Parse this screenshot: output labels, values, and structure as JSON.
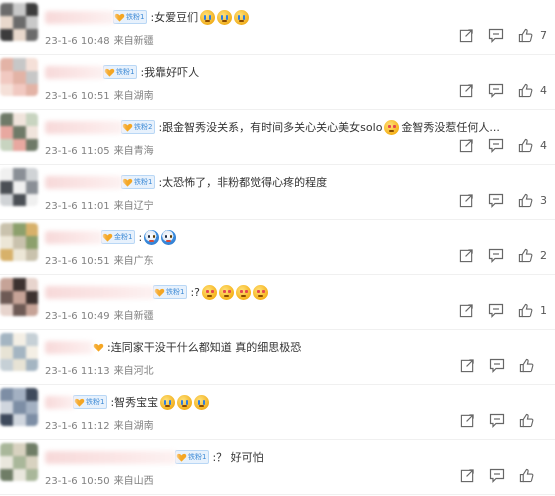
{
  "comments": [
    {
      "text": ":女爱豆们",
      "badge": "铁粉1",
      "time": "23-1-6 10:48",
      "location": "来自新疆",
      "likes": "7",
      "emojis": [
        "cry",
        "cry",
        "cry"
      ],
      "name_w": 70,
      "show_badge": true
    },
    {
      "text": ":我靠好吓人",
      "badge": "铁粉1",
      "time": "23-1-6 10:51",
      "location": "来自湖南",
      "likes": "4",
      "emojis": [],
      "name_w": 60,
      "show_badge": true
    },
    {
      "text": ":跟金智秀没关系，有时间多关心关心美女solo",
      "text2": "金智秀没惹任何人...",
      "badge": "铁粉2",
      "time": "23-1-6 11:05",
      "location": "来自青海",
      "likes": "4",
      "emojis": [],
      "name_w": 78,
      "show_badge": true
    },
    {
      "text": ":太恐怖了，非粉都觉得心疼的程度",
      "badge": "铁粉1",
      "time": "23-1-6 11:01",
      "location": "来自辽宁",
      "likes": "3",
      "emojis": [],
      "name_w": 78,
      "show_badge": true
    },
    {
      "text": ":",
      "badge": "金粉1",
      "time": "23-1-6 10:51",
      "location": "来自广东",
      "likes": "2",
      "emojis": [
        "robot",
        "robot"
      ],
      "name_w": 58,
      "show_badge": true
    },
    {
      "text": ":?",
      "badge": "铁粉1",
      "time": "23-1-6 10:49",
      "location": "来自新疆",
      "likes": "1",
      "emojis": [
        "heart-eye",
        "heart-eye",
        "heart-eye",
        "heart-eye"
      ],
      "name_w": 110,
      "show_badge": true
    },
    {
      "text": ":连同家干没干什么都知道 真的细思极恐",
      "badge": "",
      "time": "23-1-6 11:13",
      "location": "来自河北",
      "likes": "",
      "emojis": [],
      "name_w": 48,
      "show_badge": false
    },
    {
      "text": ":智秀宝宝",
      "badge": "铁粉1",
      "time": "23-1-6 11:12",
      "location": "来自湖南",
      "likes": "",
      "emojis": [
        "cry",
        "cry",
        "cry"
      ],
      "name_w": 30,
      "show_badge": true
    },
    {
      "text": ":？ 好可怕",
      "badge": "铁粉1",
      "time": "23-1-6 10:50",
      "location": "来自山西",
      "likes": "",
      "emojis": [],
      "name_w": 132,
      "show_badge": true
    }
  ],
  "avatar_palettes": [
    [
      "#6b6b6b",
      "#c9c9c9",
      "#3c3c3c",
      "#e8d8cc"
    ],
    [
      "#f1c9c1",
      "#e3b3a6",
      "#c7c7c7",
      "#f5e0d8"
    ],
    [
      "#c8d4c0",
      "#e8a8a0",
      "#6f7a68",
      "#f0e4dc"
    ],
    [
      "#8a8f96",
      "#d0d3d6",
      "#4b4f55",
      "#f0f0f0"
    ],
    [
      "#c9c2ad",
      "#8ca06c",
      "#d7b16a",
      "#ece6d6"
    ],
    [
      "#6e5a55",
      "#c6a397",
      "#3d3230",
      "#e7d4cd"
    ],
    [
      "#c6d0d6",
      "#e7e3d5",
      "#a4b5c2",
      "#f4efe5"
    ],
    [
      "#a3b0c2",
      "#3e4a5c",
      "#d0d6de",
      "#7d8ea5"
    ],
    [
      "#a9b79a",
      "#d8d2c0",
      "#6f7d66",
      "#e9e7dd"
    ]
  ],
  "colors": {
    "badge_blue": "#3f8bd6",
    "meta_gray": "#808080",
    "icon_gray": "#666666"
  }
}
